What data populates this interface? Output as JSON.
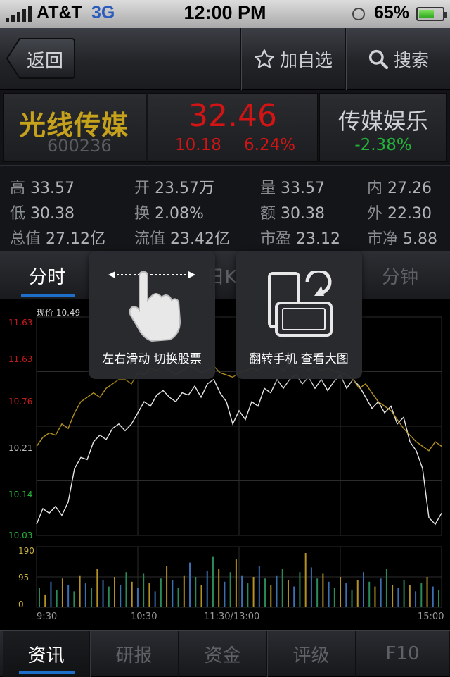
{
  "status_bar": {
    "carrier": "AT&T",
    "network": "3G",
    "time": "12:00 PM",
    "battery": "65%",
    "battery_level": 0.65
  },
  "nav": {
    "back_label": "返回",
    "watchlist_label": "加自选",
    "search_label": "搜索"
  },
  "stock": {
    "name": "光线传媒",
    "code": "600236",
    "price": "32.46",
    "change": "10.18",
    "change_pct": "6.24%",
    "sector": "传媒娱乐",
    "sector_change": "-2.38%"
  },
  "stats": [
    {
      "key": "高",
      "value": "33.57"
    },
    {
      "key": "开",
      "value": "23.57万"
    },
    {
      "key": "量",
      "value": "33.57"
    },
    {
      "key": "内",
      "value": "27.26"
    },
    {
      "key": "低",
      "value": "30.38"
    },
    {
      "key": "换",
      "value": "2.08%"
    },
    {
      "key": "额",
      "value": "30.38"
    },
    {
      "key": "外",
      "value": "22.30"
    },
    {
      "key": "总值",
      "value": "27.12亿"
    },
    {
      "key": "流值",
      "value": "23.42亿"
    },
    {
      "key": "市盈",
      "value": "23.12"
    },
    {
      "key": "市净",
      "value": "5.88"
    }
  ],
  "tabs": [
    {
      "label": "分时"
    },
    {
      "label": "日K"
    },
    {
      "label": "分钟"
    }
  ],
  "hints": {
    "swipe": "左右滑动 切换股票",
    "rotate": "翻转手机 查看大图"
  },
  "chart_data": {
    "type": "line",
    "current_label": "现价 10.49",
    "y_ticks": [
      "11.63",
      "11.63",
      "10.76",
      "10.21",
      "10.14",
      "10.03"
    ],
    "y_tick_colors": [
      "#c71b1b",
      "#c71b1b",
      "#c71b1b",
      "#b8b8b8",
      "#22b33a",
      "#22b33a"
    ],
    "x_ticks": [
      "9:30",
      "10:30",
      "11:30/13:00",
      "15:00"
    ],
    "volume_ticks": [
      "190",
      "95",
      "0"
    ],
    "series": [
      {
        "color": "#e6e6e6",
        "values": [
          10.05,
          10.12,
          10.1,
          10.13,
          10.09,
          10.15,
          10.3,
          10.35,
          10.34,
          10.42,
          10.45,
          10.43,
          10.48,
          10.5,
          10.47,
          10.5,
          10.55,
          10.6,
          10.58,
          10.63,
          10.65,
          10.62,
          10.6,
          10.64,
          10.63,
          10.67,
          10.62,
          10.68,
          10.7,
          10.64,
          10.6,
          10.5,
          10.56,
          10.52,
          10.6,
          10.58,
          10.66,
          10.64,
          10.7,
          10.66,
          10.7,
          10.72,
          10.68,
          10.71,
          10.66,
          10.7,
          10.65,
          10.69,
          10.72,
          10.66,
          10.7,
          10.67,
          10.62,
          10.57,
          10.6,
          10.55,
          10.58,
          10.5,
          10.53,
          10.42,
          10.38,
          10.3,
          10.08,
          10.05,
          10.1
        ]
      },
      {
        "color": "#b39122",
        "values": [
          10.4,
          10.44,
          10.46,
          10.45,
          10.5,
          10.48,
          10.55,
          10.6,
          10.62,
          10.64,
          10.62,
          10.66,
          10.68,
          10.7,
          10.7,
          10.68,
          10.73,
          10.72,
          10.75,
          10.74,
          10.76,
          10.74,
          10.72,
          10.74,
          10.76,
          10.75,
          10.73,
          10.74,
          10.76,
          10.73,
          10.72,
          10.71,
          10.73,
          10.74,
          10.75,
          10.74,
          10.77,
          10.75,
          10.76,
          10.74,
          10.77,
          10.75,
          10.76,
          10.74,
          10.76,
          10.74,
          10.75,
          10.74,
          10.73,
          10.72,
          10.7,
          10.66,
          10.68,
          10.64,
          10.6,
          10.58,
          10.56,
          10.52,
          10.48,
          10.45,
          10.42,
          10.4,
          10.38,
          10.42,
          10.4
        ]
      }
    ],
    "volume": [
      60,
      40,
      80,
      55,
      90,
      70,
      50,
      100,
      75,
      60,
      120,
      85,
      65,
      95,
      70,
      110,
      80,
      60,
      105,
      75,
      50,
      90,
      130,
      85,
      60,
      100,
      140,
      95,
      70,
      115,
      160,
      120,
      80,
      110,
      150,
      100,
      75,
      95,
      130,
      90,
      70,
      100,
      120,
      85,
      65,
      110,
      170,
      125,
      90,
      105,
      80,
      60,
      95,
      75,
      55,
      85,
      110,
      80,
      65,
      90,
      120,
      70,
      60,
      85,
      70,
      50,
      75,
      95,
      65,
      55
    ]
  },
  "bottom_tabs": [
    {
      "label": "资讯"
    },
    {
      "label": "研报"
    },
    {
      "label": "资金"
    },
    {
      "label": "评级"
    },
    {
      "label": "F10"
    }
  ]
}
